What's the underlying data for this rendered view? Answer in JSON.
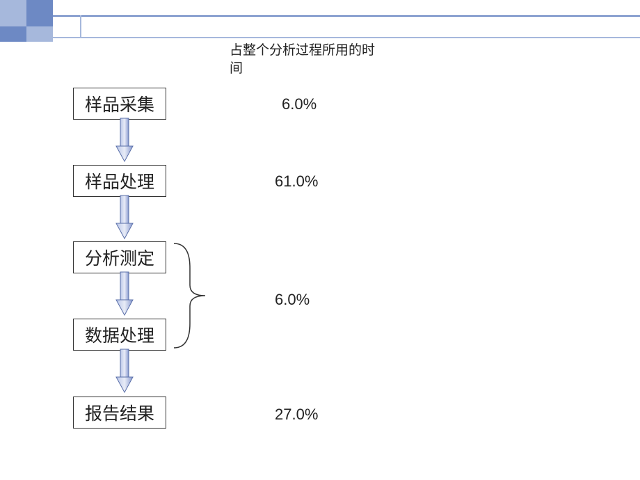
{
  "header": {
    "label": "占整个分析过程所用的时间"
  },
  "flow": {
    "boxes": [
      {
        "label": "样品采集"
      },
      {
        "label": "样品处理"
      },
      {
        "label": "分析测定"
      },
      {
        "label": "数据处理"
      },
      {
        "label": "报告结果"
      }
    ]
  },
  "percentages": {
    "p1": "6.0%",
    "p2": "61.0%",
    "p3": "6.0%",
    "p4": "27.0%"
  },
  "chart_data": {
    "type": "table",
    "title": "占整个分析过程所用的时间",
    "rows": [
      {
        "step": "样品采集",
        "time_pct": 6.0
      },
      {
        "step": "样品处理",
        "time_pct": 61.0
      },
      {
        "step_group": [
          "分析测定",
          "数据处理"
        ],
        "time_pct": 6.0
      },
      {
        "step": "报告结果",
        "time_pct": 27.0
      }
    ]
  }
}
